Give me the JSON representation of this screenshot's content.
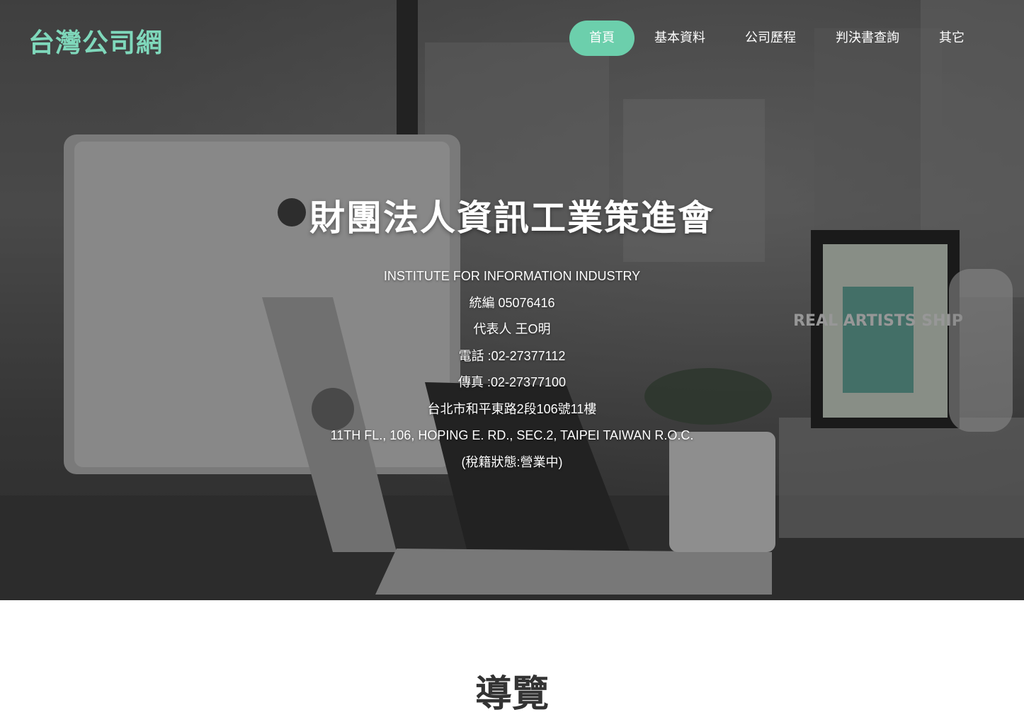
{
  "brand": {
    "logo_text": "台灣公司網",
    "accent_color": "#6ccfac"
  },
  "nav": {
    "items": [
      {
        "label": "首頁",
        "active": true
      },
      {
        "label": "基本資料",
        "active": false
      },
      {
        "label": "公司歷程",
        "active": false
      },
      {
        "label": "判決書查詢",
        "active": false
      },
      {
        "label": "其它",
        "active": false
      }
    ]
  },
  "hero": {
    "company_name": "財團法人資訊工業策進會",
    "english_name": "INSTITUTE FOR INFORMATION INDUSTRY",
    "tax_id": "統編 05076416",
    "representative": "代表人 王O明",
    "phone": "電話 :02-27377112",
    "fax": "傳真 :02-27377100",
    "address_zh": "台北市和平東路2段106號11樓",
    "address_en": "11TH FL., 106, HOPING E. RD., SEC.2, TAIPEI TAIWAN R.O.C.",
    "tax_status": "(稅籍狀態:營業中)",
    "poster_text": "REAL ARTISTS SHIP"
  },
  "section": {
    "title": "導覽"
  }
}
